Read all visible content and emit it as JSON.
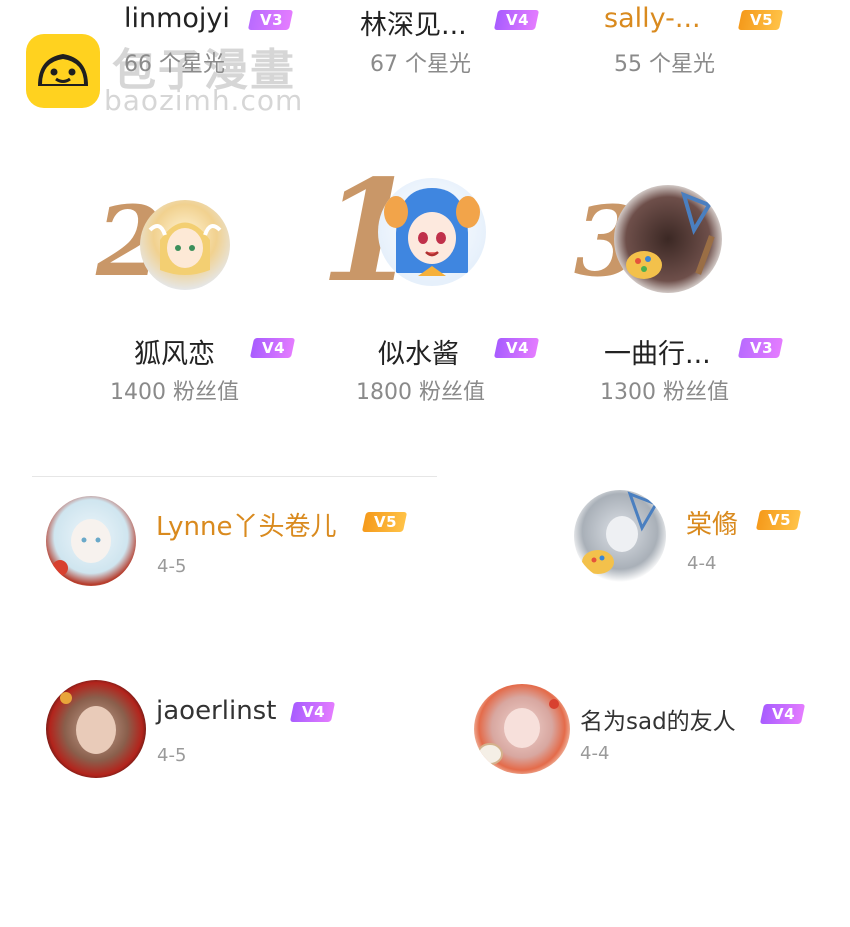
{
  "watermark": {
    "logo_text": "包子漫畫",
    "url": "baozimh.com"
  },
  "top_row": [
    {
      "name": "linmojyi",
      "level": "V3",
      "stat": "66 个星光"
    },
    {
      "name": "林深见...",
      "level": "V4",
      "stat": "67 个星光"
    },
    {
      "name": "sally-...",
      "level": "V5",
      "stat": "55 个星光"
    }
  ],
  "podium": [
    {
      "rank": "2",
      "name": "狐风恋",
      "level": "V4",
      "stat": "1400 粉丝值"
    },
    {
      "rank": "1",
      "name": "似水酱",
      "level": "V4",
      "stat": "1800 粉丝值"
    },
    {
      "rank": "3",
      "name": "一曲行...",
      "level": "V3",
      "stat": "1300 粉丝值"
    }
  ],
  "users": [
    {
      "name": "Lynne丫头卷儿",
      "level": "V5",
      "date": "4-5"
    },
    {
      "name": "棠翛",
      "level": "V5",
      "date": "4-4"
    },
    {
      "name": "jaoerlinst",
      "level": "V4",
      "date": "4-5"
    },
    {
      "name": "名为sad的友人",
      "level": "V4",
      "date": "4-4"
    }
  ],
  "colors": {
    "v5": "#f59a1b",
    "v4": "#c06aff",
    "gold_name": "#d98a1e",
    "rank_number": "#c99768"
  }
}
